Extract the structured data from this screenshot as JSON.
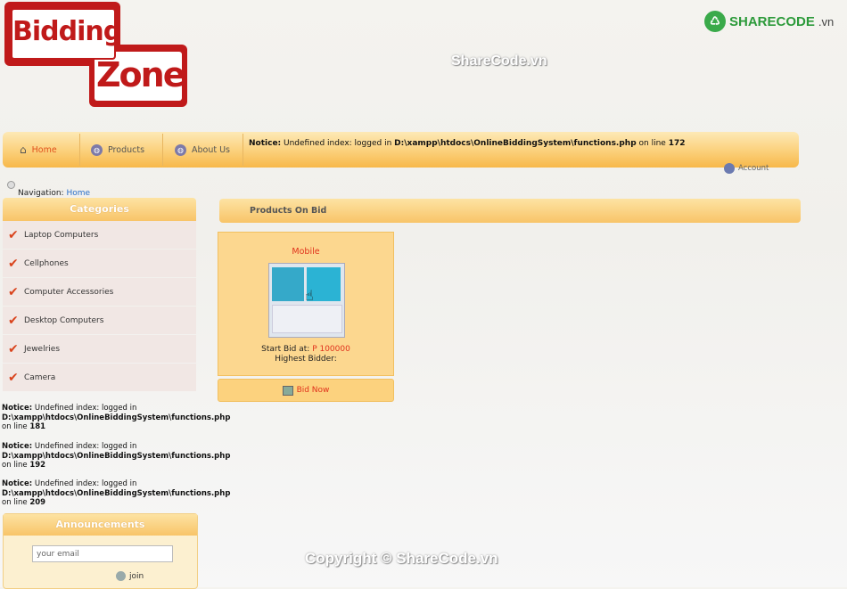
{
  "logo": {
    "line1": "Bidding",
    "line2": "Zone"
  },
  "watermarks": {
    "top": "ShareCode.vn",
    "bottom": "Copyright © ShareCode.vn",
    "brand_main": "SHARECODE",
    "brand_suffix": ".vn"
  },
  "nav": {
    "items": [
      {
        "label": "Home",
        "icon": "home-icon"
      },
      {
        "label": "Products",
        "icon": "globe-icon"
      },
      {
        "label": "About Us",
        "icon": "globe-icon"
      }
    ],
    "notice_prefix": "Notice:",
    "notice_text": " Undefined index: logged in ",
    "notice_path": "D:\\xampp\\htdocs\\OnlineBiddingSystem\\functions.php",
    "notice_suffix": " on line ",
    "notice_line": "172",
    "account_label": "Account"
  },
  "breadcrumb": {
    "label": "Navigation:",
    "link": "Home"
  },
  "categories": {
    "title": "Categories",
    "items": [
      "Laptop Computers",
      "Cellphones",
      "Computer Accessories",
      "Desktop Computers",
      "Jewelries",
      "Camera"
    ]
  },
  "side_notices": [
    {
      "prefix": "Notice:",
      "text": " Undefined index: logged in",
      "path": "D:\\xampp\\htdocs\\OnlineBiddingSystem\\functions.php",
      "line_label": "on line ",
      "line": "181"
    },
    {
      "prefix": "Notice:",
      "text": " Undefined index: logged in",
      "path": "D:\\xampp\\htdocs\\OnlineBiddingSystem\\functions.php",
      "line_label": "on line ",
      "line": "192"
    },
    {
      "prefix": "Notice:",
      "text": " Undefined index: logged in",
      "path": "D:\\xampp\\htdocs\\OnlineBiddingSystem\\functions.php",
      "line_label": "on line ",
      "line": "209"
    }
  ],
  "announcements": {
    "title": "Announcements",
    "email_placeholder": "your email",
    "join_label": "join"
  },
  "main": {
    "section_title": "Products On Bid",
    "product": {
      "title": "Mobile",
      "start_bid_label": "Start Bid at: ",
      "start_bid_value": "P 100000",
      "highest_bidder_label": "Highest Bidder:",
      "bid_button": "Bid Now"
    }
  },
  "colors": {
    "accent": "#f8c468",
    "red": "#e0321c",
    "link": "#2a6fc9"
  }
}
